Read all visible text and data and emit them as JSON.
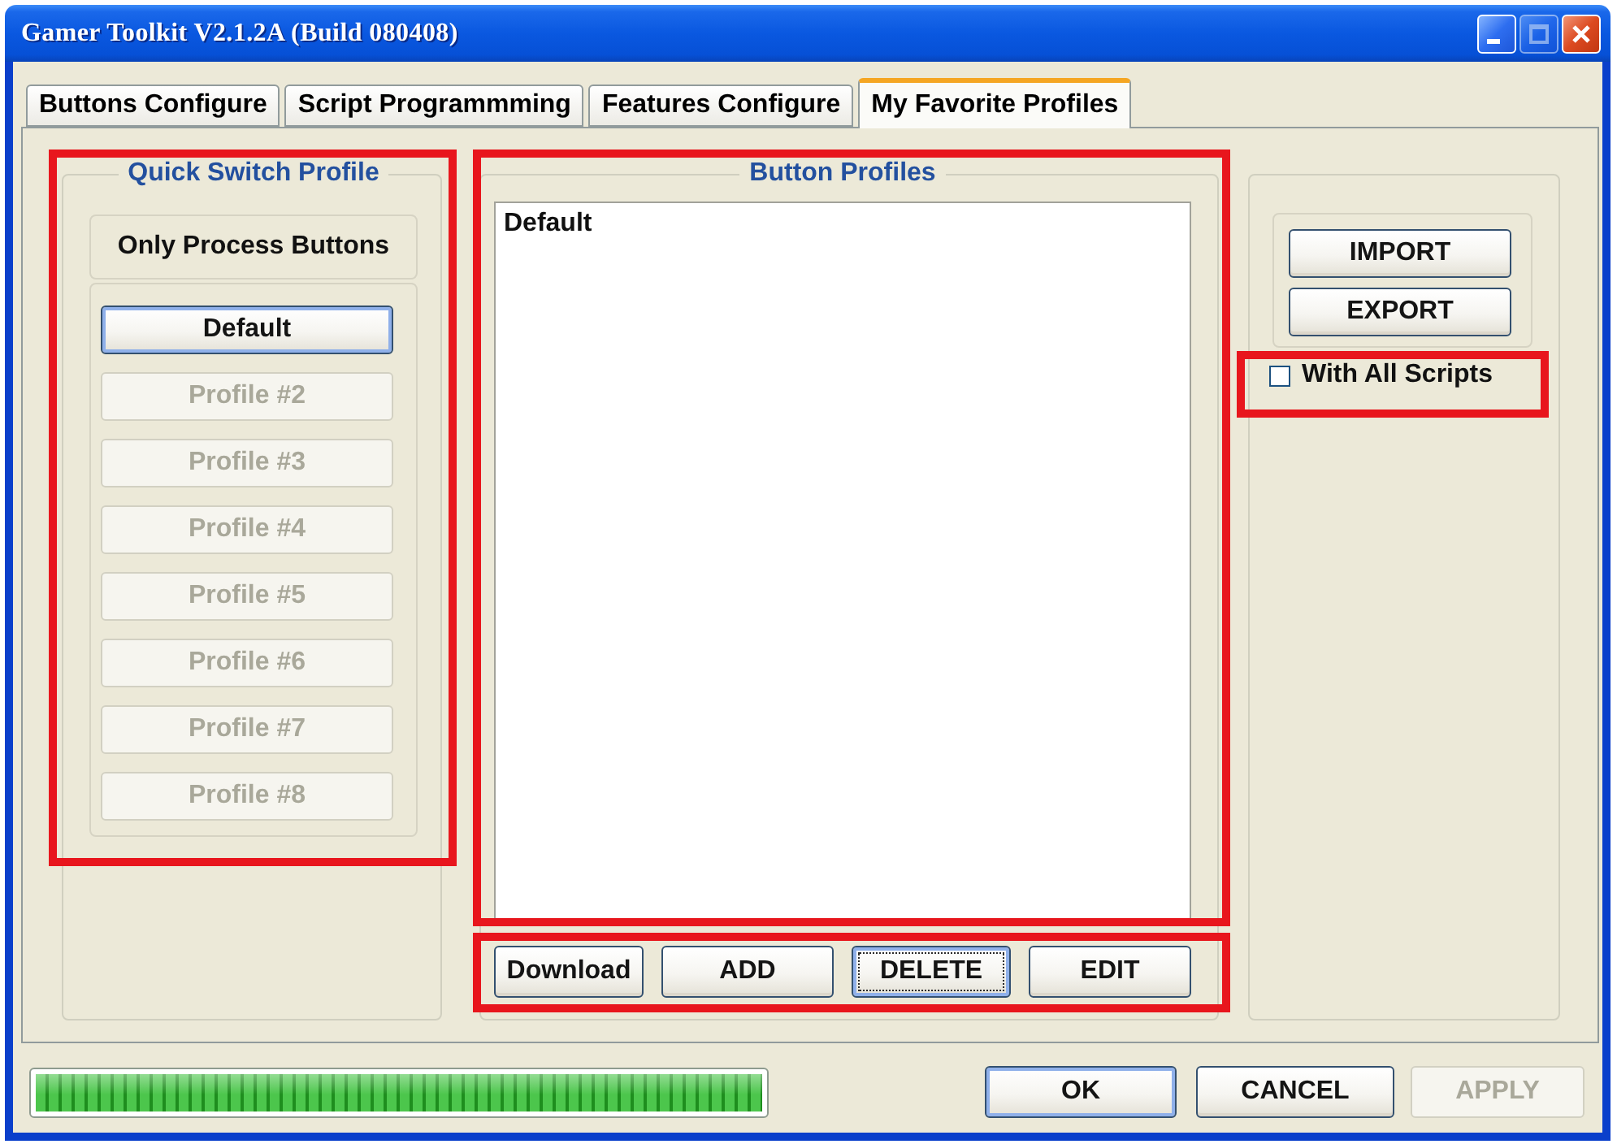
{
  "window": {
    "title": "Gamer Toolkit V2.1.2A (Build 080408)",
    "controls": [
      {
        "kind": "minimize",
        "disabled": false
      },
      {
        "kind": "maximize",
        "disabled": true
      },
      {
        "kind": "close",
        "disabled": false
      }
    ]
  },
  "tabs": [
    {
      "label": "Buttons Configure",
      "selected": false
    },
    {
      "label": "Script Programmming",
      "selected": false
    },
    {
      "label": "Features Configure",
      "selected": false
    },
    {
      "label": "My Favorite Profiles",
      "selected": true
    }
  ],
  "quick_switch": {
    "title": "Quick Switch Profile",
    "highlighted": true,
    "mode": "Only Process Buttons",
    "profiles": [
      {
        "label": "Default",
        "selected": true,
        "disabled": false
      },
      {
        "label": "Profile #2",
        "selected": false,
        "disabled": true
      },
      {
        "label": "Profile #3",
        "selected": false,
        "disabled": true
      },
      {
        "label": "Profile #4",
        "selected": false,
        "disabled": true
      },
      {
        "label": "Profile #5",
        "selected": false,
        "disabled": true
      },
      {
        "label": "Profile #6",
        "selected": false,
        "disabled": true
      },
      {
        "label": "Profile #7",
        "selected": false,
        "disabled": true
      },
      {
        "label": "Profile #8",
        "selected": false,
        "disabled": true
      }
    ]
  },
  "button_profiles": {
    "title": "Button Profiles",
    "highlighted": true,
    "items": [
      {
        "label": "Default",
        "selected": false
      }
    ],
    "actions": {
      "highlighted": true,
      "buttons": [
        {
          "label": "Download",
          "focused": false
        },
        {
          "label": "ADD",
          "focused": false
        },
        {
          "label": "DELETE",
          "focused": true
        },
        {
          "label": "EDIT",
          "focused": false
        }
      ]
    }
  },
  "transfer": {
    "buttons": [
      {
        "label": "IMPORT"
      },
      {
        "label": "EXPORT"
      }
    ],
    "with_all_scripts": {
      "label": "With All Scripts",
      "checked": false,
      "highlighted": true
    }
  },
  "footer": {
    "progress": {
      "level": 1
    },
    "buttons": [
      {
        "label": "OK",
        "default": true,
        "disabled": false
      },
      {
        "label": "CANCEL",
        "default": false,
        "disabled": false
      },
      {
        "label": "APPLY",
        "default": false,
        "disabled": true
      }
    ]
  }
}
